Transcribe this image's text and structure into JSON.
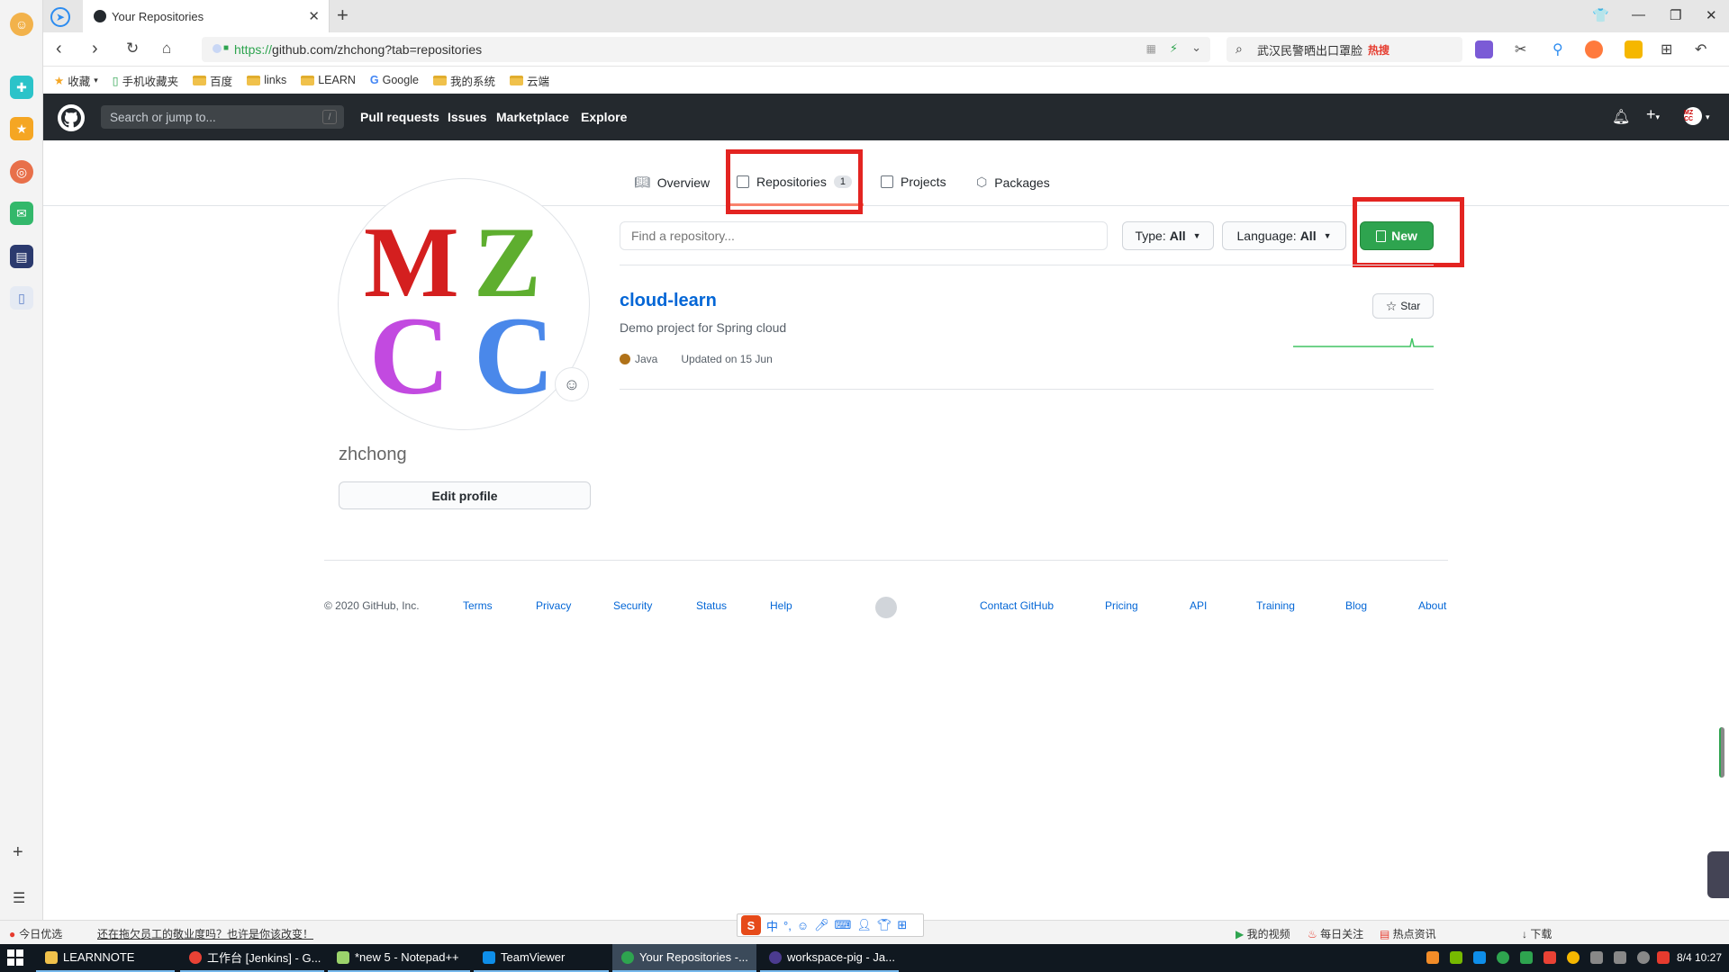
{
  "browser": {
    "tab_title": "Your Repositories",
    "url_protocol": "https://",
    "url_rest": "github.com/zhchong?tab=repositories",
    "search_text": "武汉民警晒出口罩脸",
    "search_hot": "热搜",
    "bookmarks": [
      "收藏",
      "手机收藏夹",
      "百度",
      "links",
      "LEARN",
      "Google",
      "我的系统",
      "云端"
    ]
  },
  "github": {
    "search_placeholder": "Search or jump to...",
    "slash": "/",
    "nav": [
      "Pull requests",
      "Issues",
      "Marketplace",
      "Explore"
    ],
    "avatar_text": "MZ CC"
  },
  "profile_tabs": {
    "overview": "Overview",
    "repositories": "Repositories",
    "repo_count": "1",
    "projects": "Projects",
    "packages": "Packages"
  },
  "profile": {
    "username": "zhchong",
    "edit_label": "Edit profile",
    "avatar_letters": [
      "M",
      "Z",
      "C",
      "C"
    ]
  },
  "filters": {
    "find_placeholder": "Find a repository...",
    "type_label": "Type:",
    "type_value": "All",
    "language_label": "Language:",
    "language_value": "All",
    "new_label": "New"
  },
  "repo": {
    "name": "cloud-learn",
    "description": "Demo project for Spring cloud",
    "language": "Java",
    "language_color": "#b07219",
    "updated": "Updated on 15 Jun",
    "star_label": "Star"
  },
  "footer": {
    "copyright": "© 2020 GitHub, Inc.",
    "links_left": [
      "Terms",
      "Privacy",
      "Security",
      "Status",
      "Help"
    ],
    "links_right": [
      "Contact GitHub",
      "Pricing",
      "API",
      "Training",
      "Blog",
      "About"
    ]
  },
  "statusbar": {
    "today": "今日优选",
    "news": "还在拖欠员工的敬业度吗？也许是你该改变！",
    "ime_mode": "中",
    "right_items": [
      "我的视频",
      "每日关注",
      "热点资讯",
      "下载"
    ]
  },
  "taskbar": {
    "items": [
      "LEARNNOTE",
      "工作台 [Jenkins] - G...",
      "*new 5 - Notepad++",
      "TeamViewer",
      "Your Repositories -...",
      "workspace-pig - Ja..."
    ],
    "clock": "8/4 10:27"
  },
  "colors": {
    "header_bg": "#24292e",
    "new_button": "#2ea44f",
    "link": "#0366d6",
    "highlight_box": "#e32421",
    "tab_underline": "#f9826c"
  }
}
